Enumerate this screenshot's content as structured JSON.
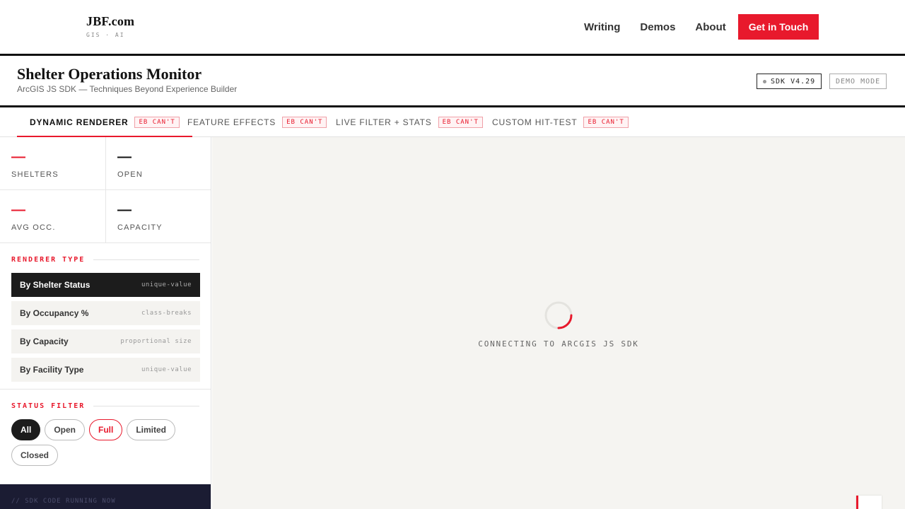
{
  "site": {
    "brand_name": "JBF.com",
    "brand_tagline": "GIS · AI",
    "nav": [
      "Writing",
      "Demos",
      "About"
    ],
    "cta": "Get in Touch"
  },
  "app": {
    "title": "Shelter Operations Monitor",
    "subtitle": "ArcGIS JS SDK — Techniques Beyond Experience Builder",
    "sdk_badge": "SDK V4.29",
    "mode_badge": "DEMO MODE"
  },
  "tabs": [
    {
      "label": "DYNAMIC RENDERER",
      "badge": "EB CAN'T"
    },
    {
      "label": "FEATURE EFFECTS",
      "badge": "EB CAN'T"
    },
    {
      "label": "LIVE FILTER + STATS",
      "badge": "EB CAN'T"
    },
    {
      "label": "CUSTOM HIT-TEST",
      "badge": "EB CAN'T"
    }
  ],
  "stats": [
    {
      "value": "—",
      "label": "SHELTERS",
      "color": "#e8192c"
    },
    {
      "value": "—",
      "label": "OPEN",
      "color": "#111111"
    },
    {
      "value": "—",
      "label": "AVG OCC.",
      "color": "#e8192c"
    },
    {
      "value": "—",
      "label": "CAPACITY",
      "color": "#111111"
    }
  ],
  "renderer_section": {
    "title": "RENDERER TYPE",
    "options": [
      {
        "label": "By Shelter Status",
        "type": "unique-value"
      },
      {
        "label": "By Occupancy %",
        "type": "class-breaks"
      },
      {
        "label": "By Capacity",
        "type": "proportional size"
      },
      {
        "label": "By Facility Type",
        "type": "unique-value"
      }
    ]
  },
  "filter_section": {
    "title": "STATUS FILTER",
    "chips": [
      "All",
      "Open",
      "Full",
      "Limited",
      "Closed"
    ]
  },
  "code_panel": {
    "line": "// SDK CODE RUNNING NOW"
  },
  "map": {
    "loading_text": "CONNECTING TO ARCGIS JS SDK"
  },
  "colors": {
    "accent": "#e8192c",
    "dark": "#1c1c1c",
    "map_bg": "#f5f4f1",
    "code_bg": "#1b1c33"
  }
}
